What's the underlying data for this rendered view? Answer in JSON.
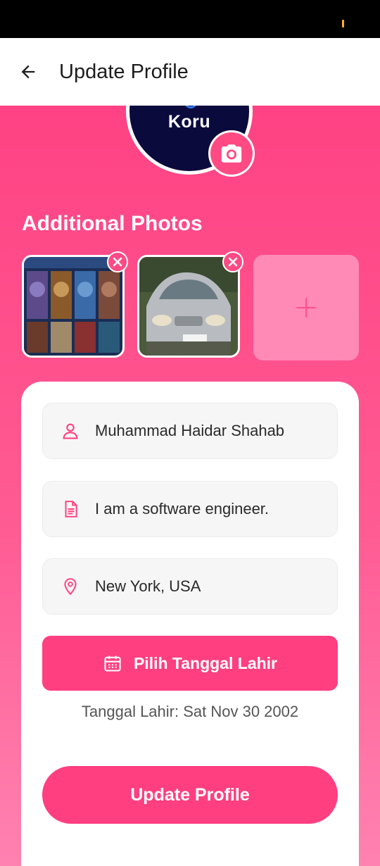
{
  "app_bar": {
    "title": "Update Profile",
    "back_icon": "arrow-left-icon"
  },
  "avatar": {
    "text": "Koru",
    "camera_icon": "camera-icon"
  },
  "additional_photos": {
    "title": "Additional Photos",
    "remove_icon": "close-icon",
    "add_icon": "plus-icon"
  },
  "form": {
    "name": {
      "value": "Muhammad Haidar Shahab",
      "icon": "person-icon"
    },
    "bio": {
      "value": "I am a software engineer.",
      "icon": "document-icon"
    },
    "location": {
      "value": "New York, USA",
      "icon": "location-pin-icon"
    },
    "date_button": {
      "label": "Pilih Tanggal Lahir",
      "icon": "calendar-icon"
    },
    "dob_text": "Tanggal Lahir: Sat Nov 30 2002",
    "submit_label": "Update Profile"
  },
  "colors": {
    "accent": "#ff3f7f",
    "background_top": "#ff4283",
    "background_bottom": "#ff82b0"
  }
}
